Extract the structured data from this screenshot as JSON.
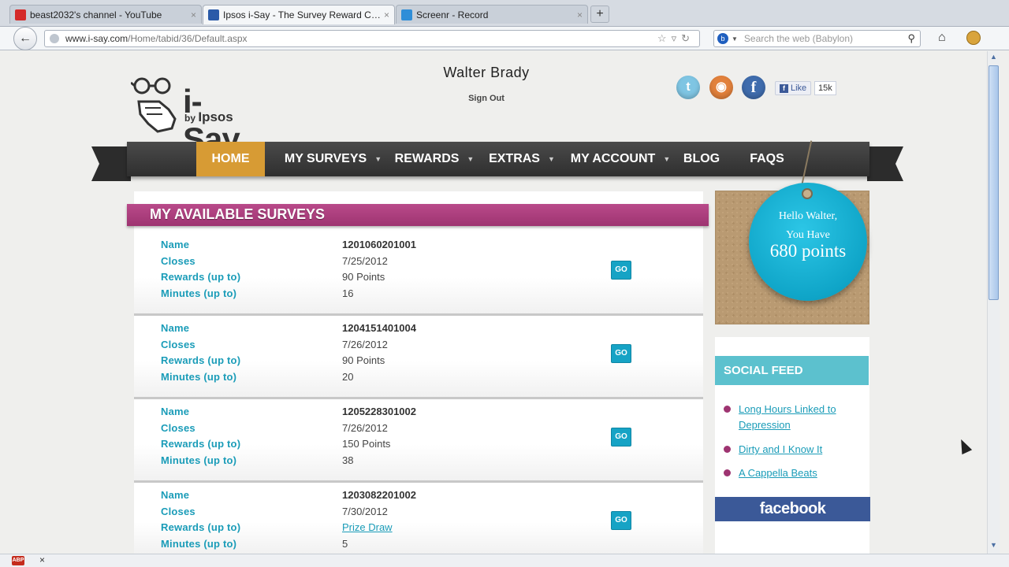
{
  "browser": {
    "tabs": [
      {
        "label": "beast2032's channel - YouTube",
        "close": "×",
        "favicon_color": "#d42a2a"
      },
      {
        "label": "Ipsos i-Say - The Survey Reward Communi...",
        "close": "×",
        "favicon_color": "#2a5aa8"
      },
      {
        "label": "Screenr - Record",
        "close": "×",
        "favicon_color": "#2f8ed8"
      }
    ],
    "new_tab": "+",
    "back": "←",
    "url_host": "www.i-say.com",
    "url_path": "/Home/tabid/36/Default.aspx",
    "url_icons": "☆▿↻",
    "search_placeholder": "Search the web (Babylon)",
    "home": "⌂",
    "status_close": "×"
  },
  "header": {
    "logo_title": "i-Say",
    "logo_by": "by",
    "logo_brand": "Ipsos",
    "user_name": "Walter Brady",
    "sign_out": "Sign Out",
    "like_label": "Like",
    "like_count": "15k"
  },
  "nav": {
    "items": [
      {
        "label": "HOME",
        "dropdown": false
      },
      {
        "label": "MY SURVEYS",
        "dropdown": true
      },
      {
        "label": "REWARDS",
        "dropdown": true
      },
      {
        "label": "EXTRAS",
        "dropdown": true
      },
      {
        "label": "MY ACCOUNT",
        "dropdown": true
      },
      {
        "label": "BLOG",
        "dropdown": false
      },
      {
        "label": "FAQS",
        "dropdown": false
      }
    ],
    "active": "HOME",
    "active_color": "#d79b34"
  },
  "surveys": {
    "title": "MY AVAILABLE SURVEYS",
    "labels": {
      "name": "Name",
      "closes": "Closes",
      "rewards": "Rewards (up to)",
      "minutes": "Minutes (up to)"
    },
    "go_label": "GO",
    "items": [
      {
        "name": "1201060201001",
        "closes": "7/25/2012",
        "rewards": "90 Points",
        "minutes": "16"
      },
      {
        "name": "1204151401004",
        "closes": "7/26/2012",
        "rewards": "90 Points",
        "minutes": "20"
      },
      {
        "name": "1205228301002",
        "closes": "7/26/2012",
        "rewards": "150 Points",
        "minutes": "38"
      },
      {
        "name": "1203082201002",
        "closes": "7/30/2012",
        "rewards": "Prize Draw",
        "minutes": "5"
      }
    ]
  },
  "sidebar": {
    "hello": "Hello Walter,",
    "you_have": "You Have",
    "points": "680 points",
    "social_feed_title": "SOCIAL FEED",
    "feed_links": [
      "Long Hours Linked to Depression",
      "Dirty and I Know It",
      "A Cappella Beats"
    ],
    "facebook_label": "facebook"
  },
  "colors": {
    "accent_teal": "#1a9cb8",
    "banner_magenta": "#b94a8a",
    "go_button": "#16a3c5",
    "facebook_blue": "#3b5998"
  }
}
